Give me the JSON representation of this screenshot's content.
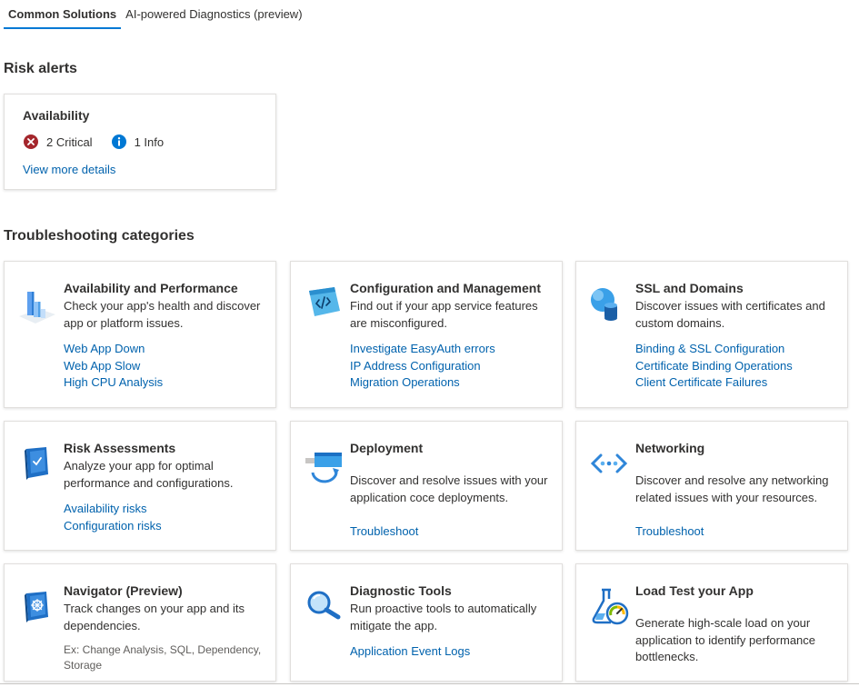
{
  "tabs": [
    {
      "label": "Common Solutions",
      "active": true
    },
    {
      "label": "AI-powered Diagnostics (preview)",
      "active": false
    }
  ],
  "risk_alerts": {
    "section_title": "Risk alerts",
    "card": {
      "title": "Availability",
      "critical_label": "2 Critical",
      "info_label": "1 Info",
      "link": "View more details"
    }
  },
  "troubleshooting": {
    "section_title": "Troubleshooting categories",
    "categories": [
      {
        "title": "Availability and Performance",
        "desc": "Check your app's health and discover app or platform issues.",
        "links": [
          "Web App Down",
          "Web App Slow",
          "High CPU Analysis"
        ]
      },
      {
        "title": "Configuration and Management",
        "desc": "Find out if your app service features are misconfigured.",
        "links": [
          "Investigate EasyAuth errors",
          "IP Address Configuration",
          "Migration Operations"
        ]
      },
      {
        "title": "SSL and Domains",
        "desc": "Discover issues with certificates and custom domains.",
        "links": [
          "Binding & SSL Configuration",
          "Certificate Binding Operations",
          "Client Certificate Failures"
        ]
      },
      {
        "title": "Risk Assessments",
        "desc": "Analyze your app for optimal performance and configurations.",
        "links": [
          "Availability risks",
          "Configuration risks"
        ]
      },
      {
        "title": "Deployment",
        "desc": "Discover and resolve issues with your application coce deployments.",
        "links": [
          "Troubleshoot"
        ]
      },
      {
        "title": "Networking",
        "desc": "Discover and resolve any networking related issues with your resources.",
        "links": [
          "Troubleshoot"
        ]
      },
      {
        "title": "Navigator (Preview)",
        "desc": "Track changes on your app and its dependencies.",
        "hint": "Ex: Change Analysis, SQL, Dependency, Storage"
      },
      {
        "title": "Diagnostic Tools",
        "desc": "Run proactive tools to automatically mitigate the app.",
        "links": [
          "Application Event Logs"
        ]
      },
      {
        "title": "Load Test your App",
        "desc": "Generate high-scale load on your application to identify performance bottlenecks."
      }
    ]
  },
  "icons": {
    "critical": "critical-error-icon",
    "info": "info-icon",
    "availability": "availability-performance-icon",
    "configuration": "configuration-management-icon",
    "ssl": "ssl-domains-icon",
    "risk": "risk-assessment-book-icon",
    "deployment": "deployment-icon",
    "networking": "networking-icon",
    "navigator": "navigator-icon",
    "diagnostic": "magnifier-icon",
    "loadtest": "load-test-flask-icon"
  },
  "colors": {
    "accent": "#0078d4",
    "link": "#0062ad",
    "critical": "#a4262c",
    "info": "#0078d4"
  }
}
